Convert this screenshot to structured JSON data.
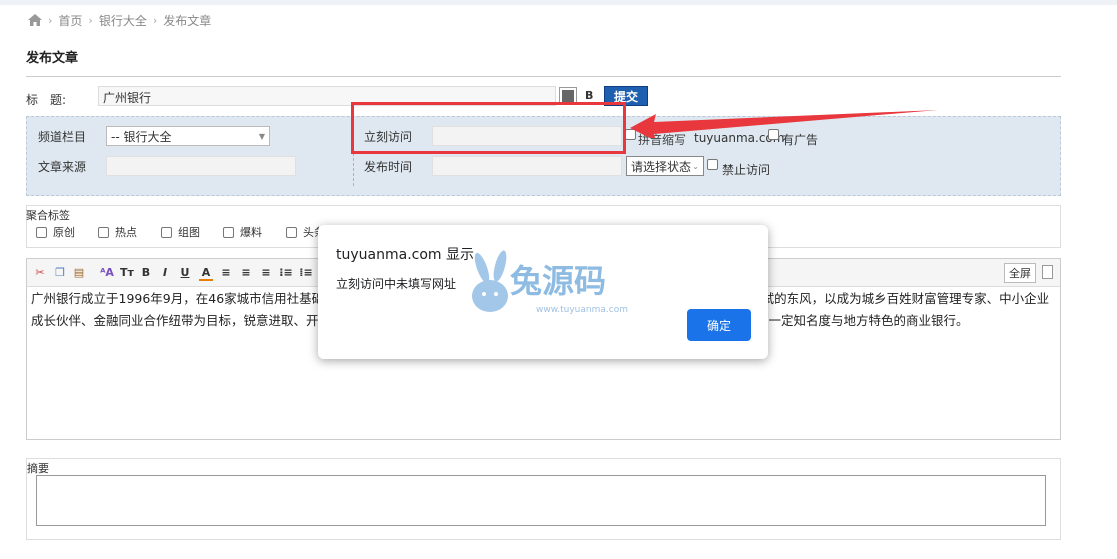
{
  "breadcrumb": {
    "items": [
      "首页",
      "银行大全",
      "发布文章"
    ]
  },
  "page_title": "发布文章",
  "form": {
    "title_label": "标　题:",
    "title_value": "广州银行",
    "bold_label": "B",
    "submit_label": "提交",
    "channel_label": "频道栏目",
    "channel_value": "-- 银行大全",
    "source_label": "文章来源",
    "visit_label": "立刻访问",
    "pinyin_text": "拼音缩写",
    "domain_text": "tuyuanma.com",
    "ad_label": "有广告",
    "publish_time_label": "发布时间",
    "status_value": "请选择状态",
    "forbid_label": "禁止访问"
  },
  "tags": {
    "legend": "聚合标签",
    "items": [
      "原创",
      "热点",
      "组图",
      "爆料",
      "头条"
    ]
  },
  "editor": {
    "fullscreen_label": "全屏",
    "content": "广州银行成立于1996年9月，在46家城市信用社基础上组建而成，秉承务实、稳健、创新、进取的经营理念，坚持实干为先、勇于尝试的东风，以成为城乡百姓财富管理专家、中小企业成长伙伴、金融同业合作纽带为目标，锐意进取、开拓创新，各项业务稳健发展，经营效益持续提升，综合实力不断增强，是国内具有一定知名度与地方特色的商业银行。"
  },
  "summary": {
    "label": "摘要"
  },
  "dialog": {
    "title": "tuyuanma.com 显示",
    "message": "立刻访问中未填写网址",
    "ok_label": "确定"
  },
  "watermark": {
    "brand": "兔源码",
    "url": "www.tuyuanma.com"
  },
  "colors": {
    "accent": "#1a73e8",
    "submit": "#1f5fb0",
    "highlight": "#e8383d",
    "panel": "#dfe8f1"
  }
}
